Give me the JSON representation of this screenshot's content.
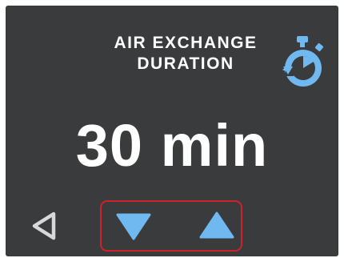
{
  "header": {
    "title_line1": "AIR EXCHANGE",
    "title_line2": "DURATION",
    "icon": "timer-icon"
  },
  "main": {
    "value_text": "30 min"
  },
  "controls": {
    "back_icon": "back-triangle-icon",
    "decrease_icon": "arrow-down-icon",
    "increase_icon": "arrow-up-icon"
  },
  "colors": {
    "background": "#3a3b3d",
    "text": "#ffffff",
    "accent_blue": "#6fb9f0",
    "selection_border": "#d0202a"
  }
}
